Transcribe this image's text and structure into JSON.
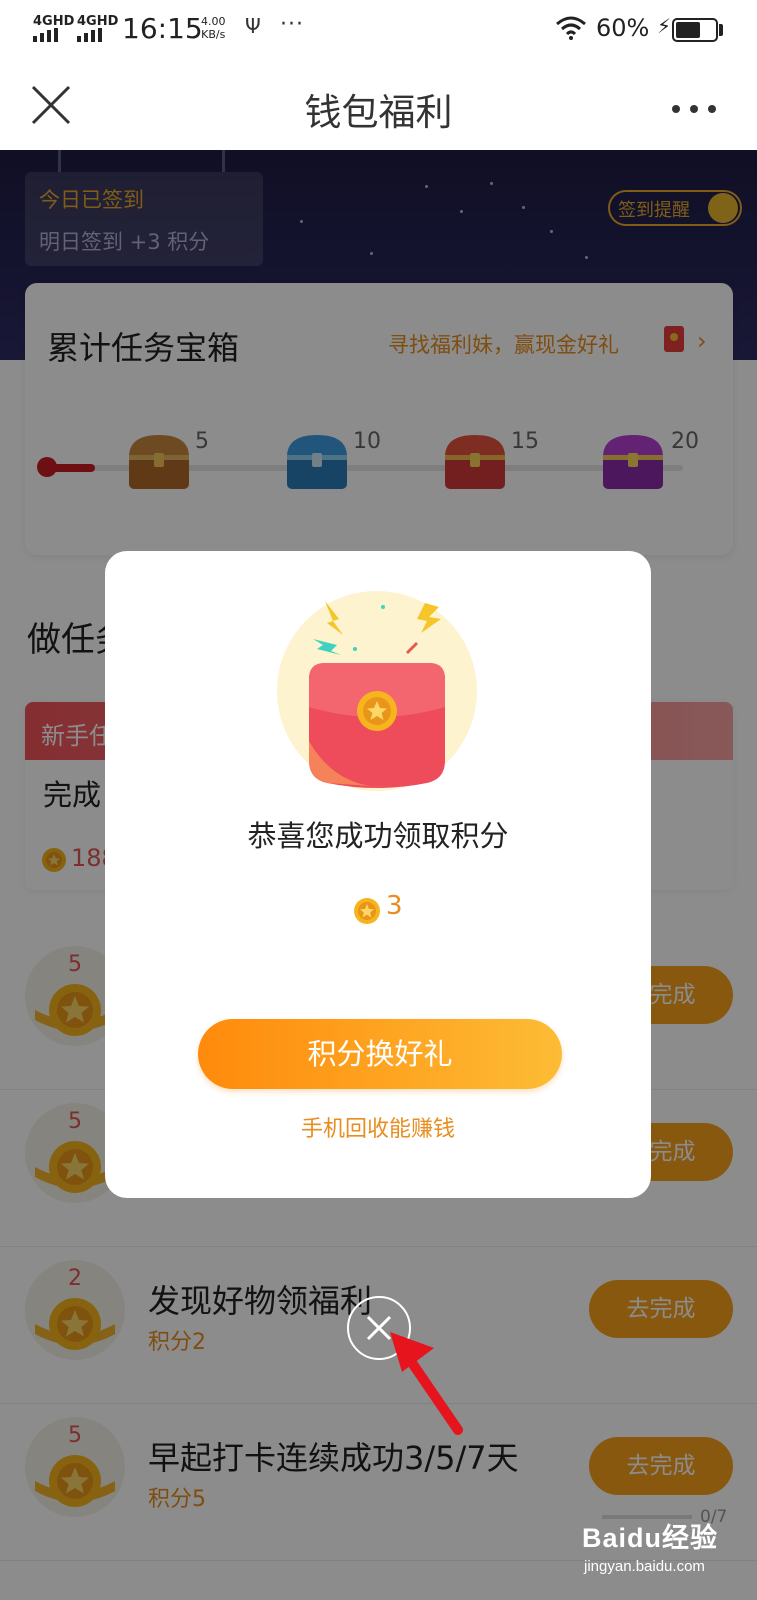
{
  "status_bar": {
    "network_1": "4GHD",
    "network_2": "4GHD",
    "time": "16:15",
    "speed_value": "4.00",
    "speed_unit": "KB/s",
    "more": "···",
    "battery_percent": "60%"
  },
  "nav": {
    "title": "钱包福利"
  },
  "hero": {
    "signin_status": "今日已签到",
    "signin_next": "明日签到 +3 积分",
    "remind_label": "签到提醒"
  },
  "chest_card": {
    "title": "累计任务宝箱",
    "link_text": "寻找福利妹，赢现金好礼",
    "milestones": [
      "5",
      "10",
      "15",
      "20"
    ]
  },
  "section": {
    "title_visible": "做任务"
  },
  "newbie": {
    "tag": "新手任务",
    "body": "完成",
    "points": "188"
  },
  "tasks": [
    {
      "badge": "5",
      "title": "",
      "points": "",
      "button": "去完成"
    },
    {
      "badge": "5",
      "title": "",
      "points": "",
      "button": "去完成"
    },
    {
      "badge": "2",
      "title": "发现好物领福利",
      "points": "积分2",
      "button": "去完成"
    },
    {
      "badge": "5",
      "title": "早起打卡连续成功3/5/7天",
      "points": "积分5",
      "button": "去完成",
      "progress": "0/7"
    }
  ],
  "modal": {
    "title": "恭喜您成功领取积分",
    "points": "3",
    "button": "积分换好礼",
    "link": "手机回收能赚钱"
  },
  "watermark": {
    "brand": "Baidu经验",
    "url": "jingyan.baidu.com"
  },
  "colors": {
    "accent_orange": "#f7a01c",
    "hero_navy": "#1d1c44",
    "red": "#c81d26"
  }
}
